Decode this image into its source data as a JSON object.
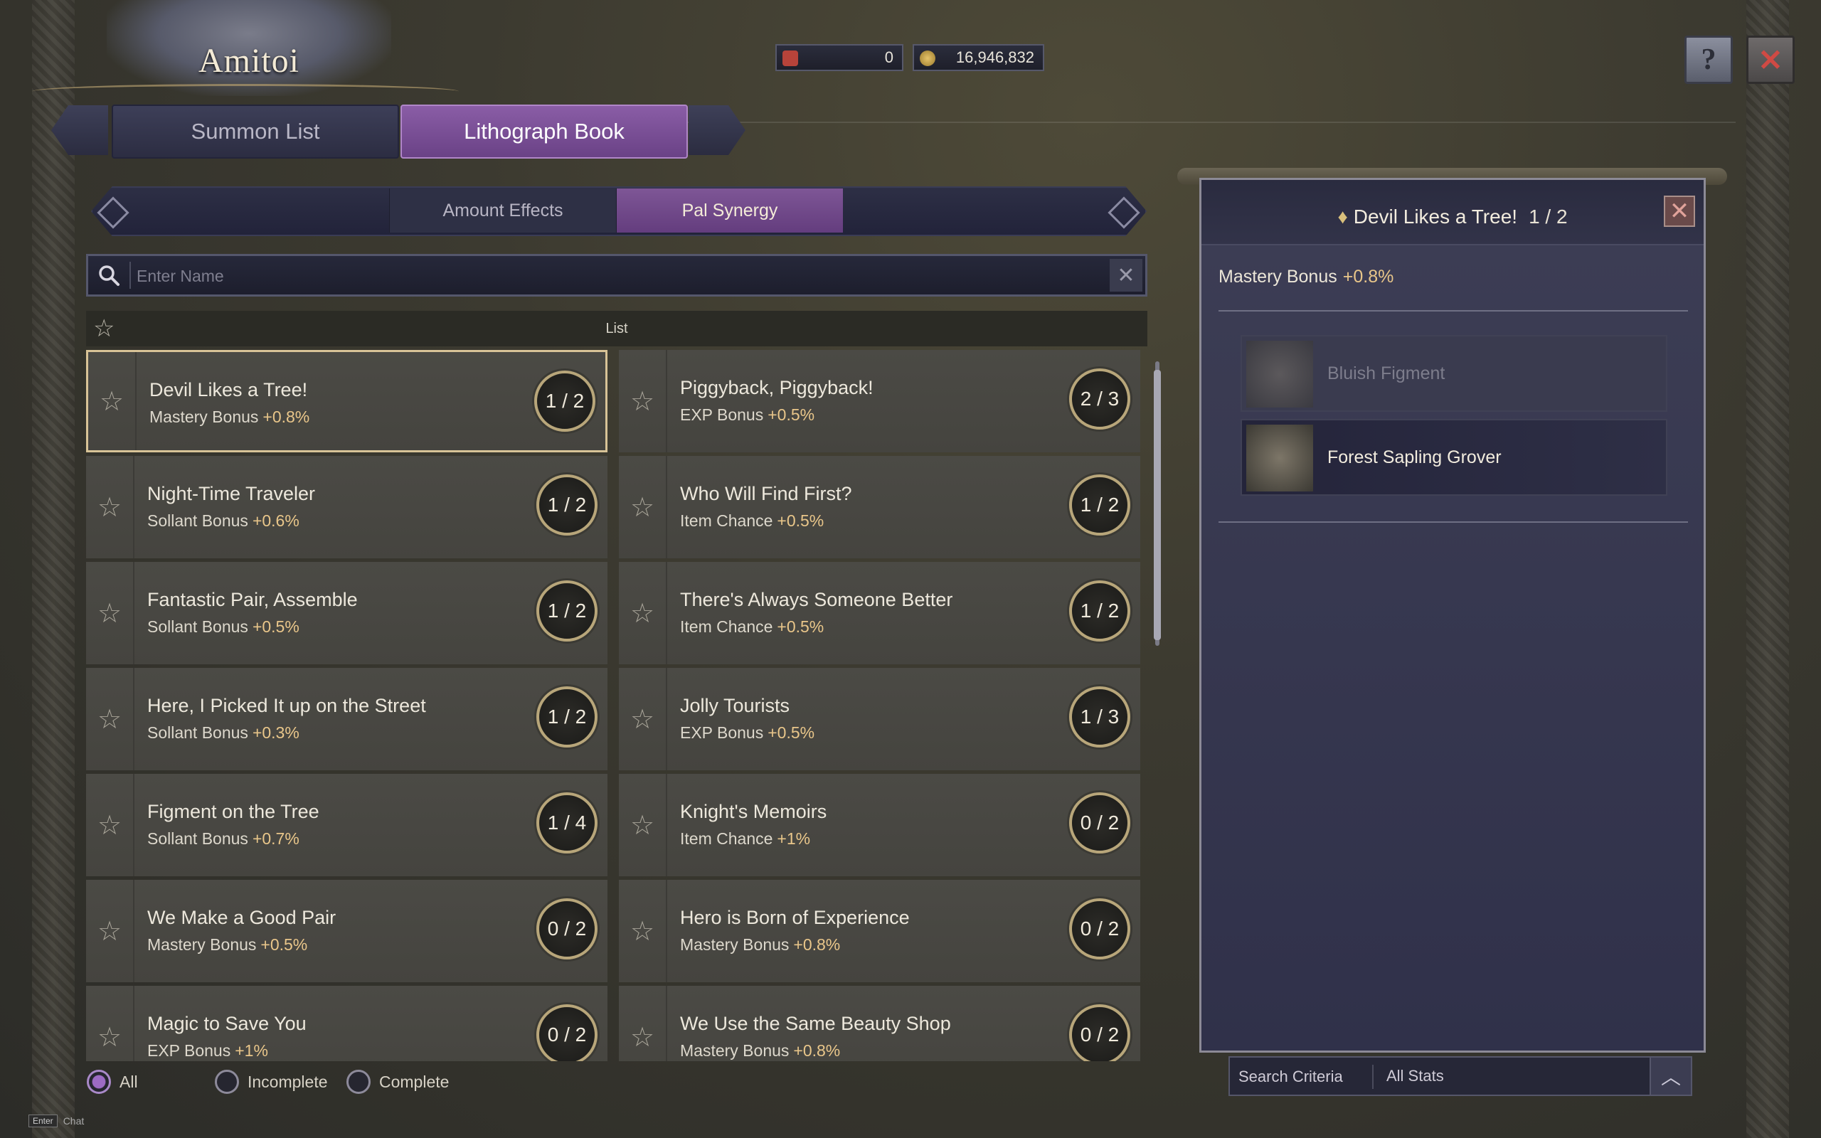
{
  "window": {
    "title": "Amitoi"
  },
  "currencies": [
    {
      "icon": "ticket-icon",
      "value": "0"
    },
    {
      "icon": "gold-coin-icon",
      "value": "16,946,832"
    }
  ],
  "main_tabs": [
    {
      "label": "Summon List",
      "active": false
    },
    {
      "label": "Lithograph Book",
      "active": true
    }
  ],
  "sub_tabs": [
    {
      "label": "Amount Effects",
      "active": false
    },
    {
      "label": "Pal Synergy",
      "active": true
    }
  ],
  "search": {
    "placeholder": "Enter Name",
    "value": ""
  },
  "list_header": {
    "label": "List"
  },
  "cards": [
    {
      "name": "Devil Likes a Tree!",
      "stat": "Mastery Bonus",
      "value": "+0.8%",
      "progress": "1 / 2",
      "selected": true
    },
    {
      "name": "Piggyback, Piggyback!",
      "stat": "EXP Bonus",
      "value": "+0.5%",
      "progress": "2 / 3"
    },
    {
      "name": "Night-Time Traveler",
      "stat": "Sollant Bonus",
      "value": "+0.6%",
      "progress": "1 / 2"
    },
    {
      "name": "Who Will Find First?",
      "stat": "Item Chance",
      "value": "+0.5%",
      "progress": "1 / 2"
    },
    {
      "name": "Fantastic Pair, Assemble",
      "stat": "Sollant Bonus",
      "value": "+0.5%",
      "progress": "1 / 2"
    },
    {
      "name": "There's Always Someone Better",
      "stat": "Item Chance",
      "value": "+0.5%",
      "progress": "1 / 2"
    },
    {
      "name": "Here, I Picked It up on the Street",
      "stat": "Sollant Bonus",
      "value": "+0.3%",
      "progress": "1 / 2"
    },
    {
      "name": "Jolly Tourists",
      "stat": "EXP Bonus",
      "value": "+0.5%",
      "progress": "1 / 3"
    },
    {
      "name": "Figment on the Tree",
      "stat": "Sollant Bonus",
      "value": "+0.7%",
      "progress": "1 / 4"
    },
    {
      "name": "Knight's Memoirs",
      "stat": "Item Chance",
      "value": "+1%",
      "progress": "0 / 2"
    },
    {
      "name": "We Make a Good Pair",
      "stat": "Mastery Bonus",
      "value": "+0.5%",
      "progress": "0 / 2"
    },
    {
      "name": "Hero is Born of Experience",
      "stat": "Mastery Bonus",
      "value": "+0.8%",
      "progress": "0 / 2"
    },
    {
      "name": "Magic to Save You",
      "stat": "EXP Bonus",
      "value": "+1%",
      "progress": "0 / 2"
    },
    {
      "name": "We Use the Same Beauty Shop",
      "stat": "Mastery Bonus",
      "value": "+0.8%",
      "progress": "0 / 2"
    }
  ],
  "filters": [
    {
      "label": "All",
      "selected": true
    },
    {
      "label": "Incomplete",
      "selected": false
    },
    {
      "label": "Complete",
      "selected": false
    }
  ],
  "chat_hint": {
    "key": "Enter",
    "label": "Chat"
  },
  "detail": {
    "title": "Devil Likes a Tree!",
    "progress": "1 / 2",
    "bonus_label": "Mastery Bonus",
    "bonus_value": "+0.8%",
    "members": [
      {
        "name": "Bluish Figment",
        "owned": false
      },
      {
        "name": "Forest Sapling Grover",
        "owned": true
      }
    ]
  },
  "search_criteria": {
    "label": "Search Criteria",
    "value": "All Stats"
  }
}
